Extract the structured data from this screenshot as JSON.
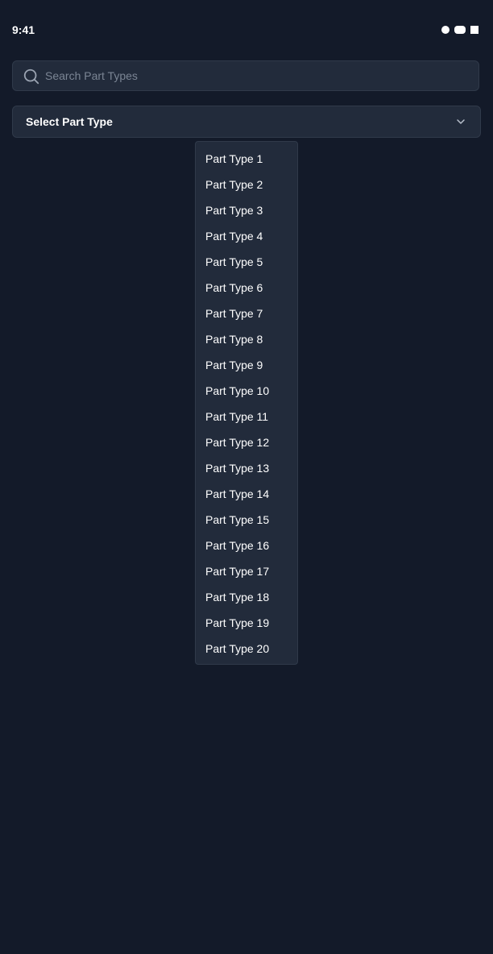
{
  "status_bar": {
    "time": "9:41",
    "icons": [
      "circle-icon",
      "battery-icon",
      "square-icon"
    ]
  },
  "search": {
    "placeholder": "Search Part Types",
    "value": "",
    "icon": "search-icon"
  },
  "select": {
    "label": "Select Part Type",
    "icon": "chevron-down-icon"
  },
  "dropdown": {
    "options": [
      "Part Type 1",
      "Part Type 2",
      "Part Type 3",
      "Part Type 4",
      "Part Type 5",
      "Part Type 6",
      "Part Type 7",
      "Part Type 8",
      "Part Type 9",
      "Part Type 10",
      "Part Type 11",
      "Part Type 12",
      "Part Type 13",
      "Part Type 14",
      "Part Type 15",
      "Part Type 16",
      "Part Type 17",
      "Part Type 18",
      "Part Type 19",
      "Part Type 20"
    ]
  },
  "colors": {
    "background": "#131a29",
    "surface": "#222b3b",
    "border": "#303a4a",
    "text": "#ffffff",
    "placeholder": "#7b8594"
  }
}
